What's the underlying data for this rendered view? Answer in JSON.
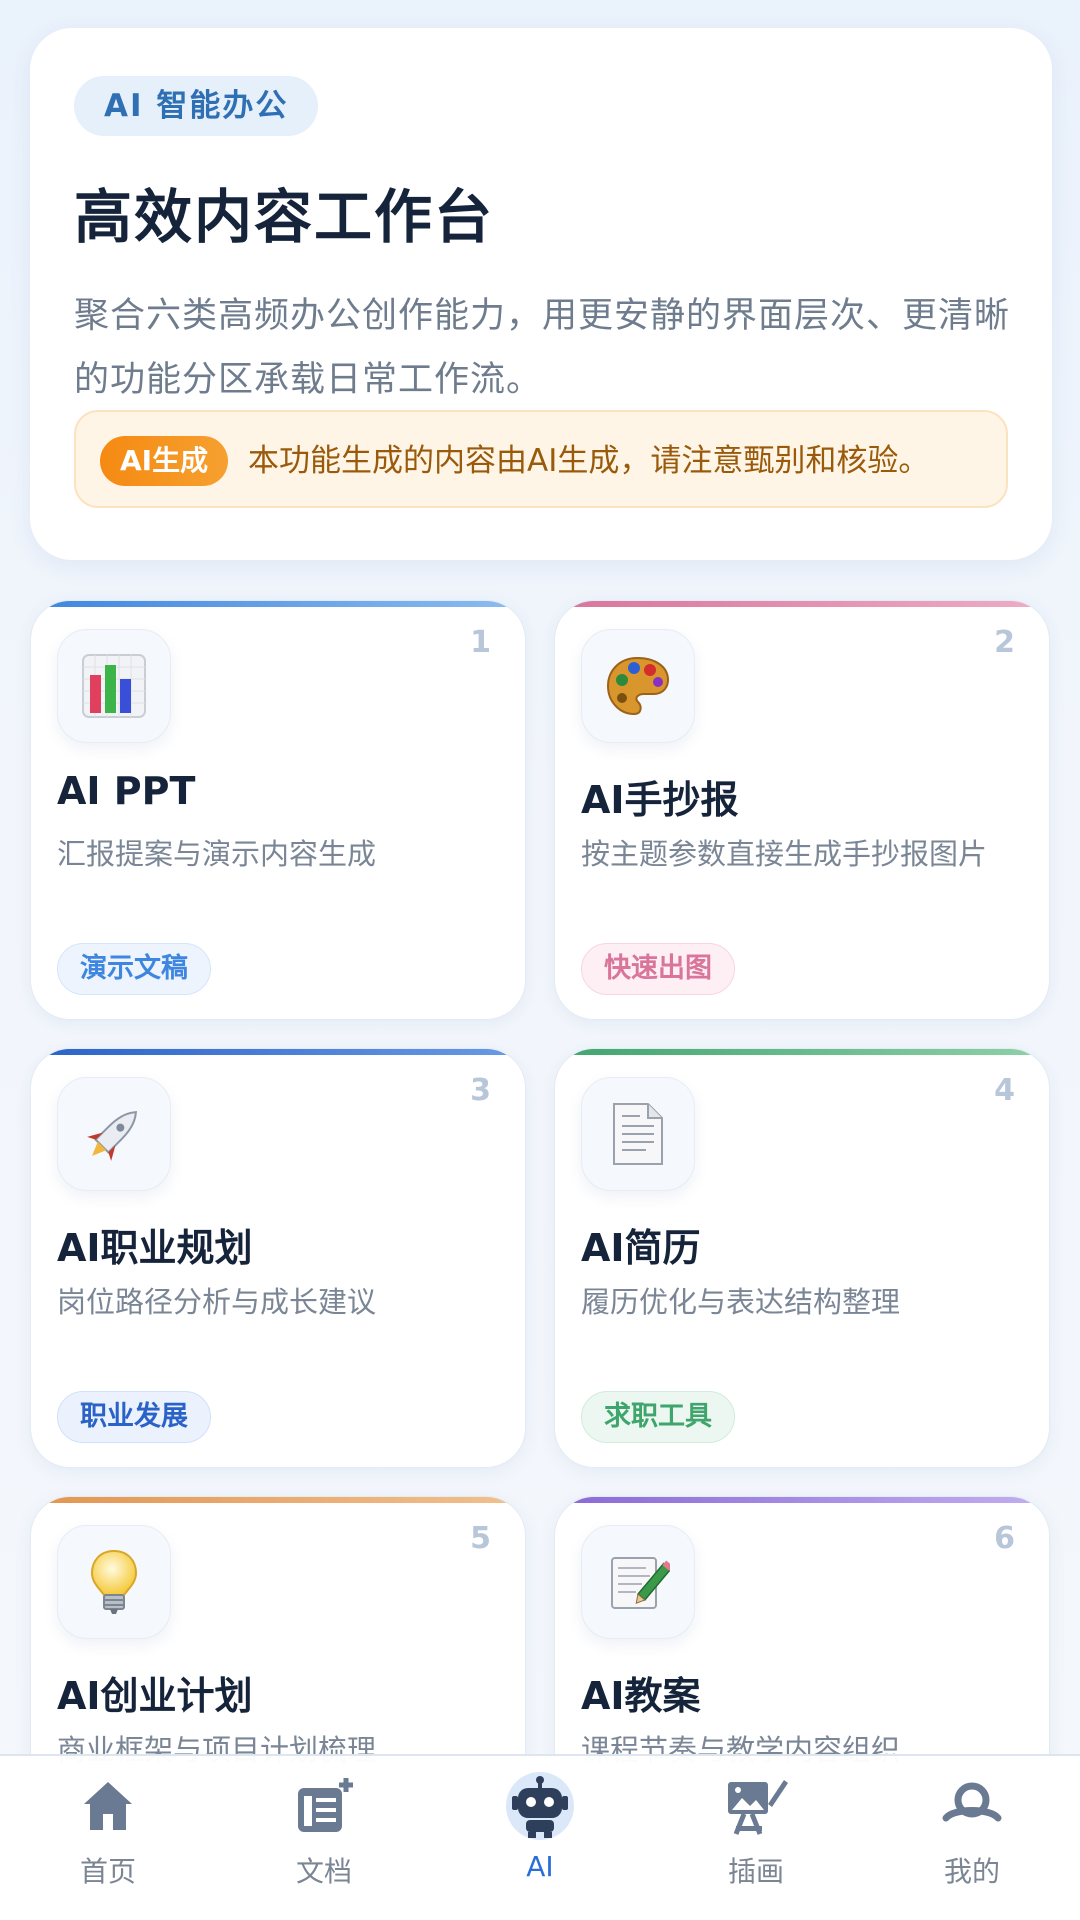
{
  "hero": {
    "badge": "AI 智能办公",
    "title": "高效内容工作台",
    "description": "聚合六类高频办公创作能力，用更安静的界面层次、更清晰的功能分区承载日常工作流。",
    "notice_tag": "AI生成",
    "notice_text": "本功能生成的内容由AI生成，请注意甄别和核验。"
  },
  "cards": [
    {
      "number": "1",
      "title": "AI PPT",
      "description": "汇报提案与演示内容生成",
      "tag": "演示文稿",
      "icon": "bar-chart-icon",
      "accent": "#5a9be6"
    },
    {
      "number": "2",
      "title": "AI手抄报",
      "description": "按主题参数直接生成手抄报图片",
      "tag": "快速出图",
      "icon": "palette-icon",
      "accent": "#e08aa8"
    },
    {
      "number": "3",
      "title": "AI职业规划",
      "description": "岗位路径分析与成长建议",
      "tag": "职业发展",
      "icon": "rocket-icon",
      "accent": "#2f6fd0"
    },
    {
      "number": "4",
      "title": "AI简历",
      "description": "履历优化与表达结构整理",
      "tag": "求职工具",
      "icon": "document-icon",
      "accent": "#56b07c"
    },
    {
      "number": "5",
      "title": "AI创业计划",
      "description": "商业框架与项目计划梳理",
      "tag": "",
      "icon": "lightbulb-icon",
      "accent": "#e6a15a"
    },
    {
      "number": "6",
      "title": "AI教案",
      "description": "课程节奏与教学内容组织",
      "tag": "",
      "icon": "memo-icon",
      "accent": "#9a7be0"
    }
  ],
  "nav": [
    {
      "label": "首页",
      "icon": "home-icon",
      "active": false
    },
    {
      "label": "文档",
      "icon": "document-add-icon",
      "active": false
    },
    {
      "label": "AI",
      "icon": "robot-icon",
      "active": true
    },
    {
      "label": "插画",
      "icon": "illustration-icon",
      "active": false
    },
    {
      "label": "我的",
      "icon": "profile-icon",
      "active": false
    }
  ],
  "colors": {
    "primary": "#2a6fd6",
    "title": "#15243a",
    "notice_bg": "#fff5e6",
    "notice_tag": "#f58a12"
  }
}
